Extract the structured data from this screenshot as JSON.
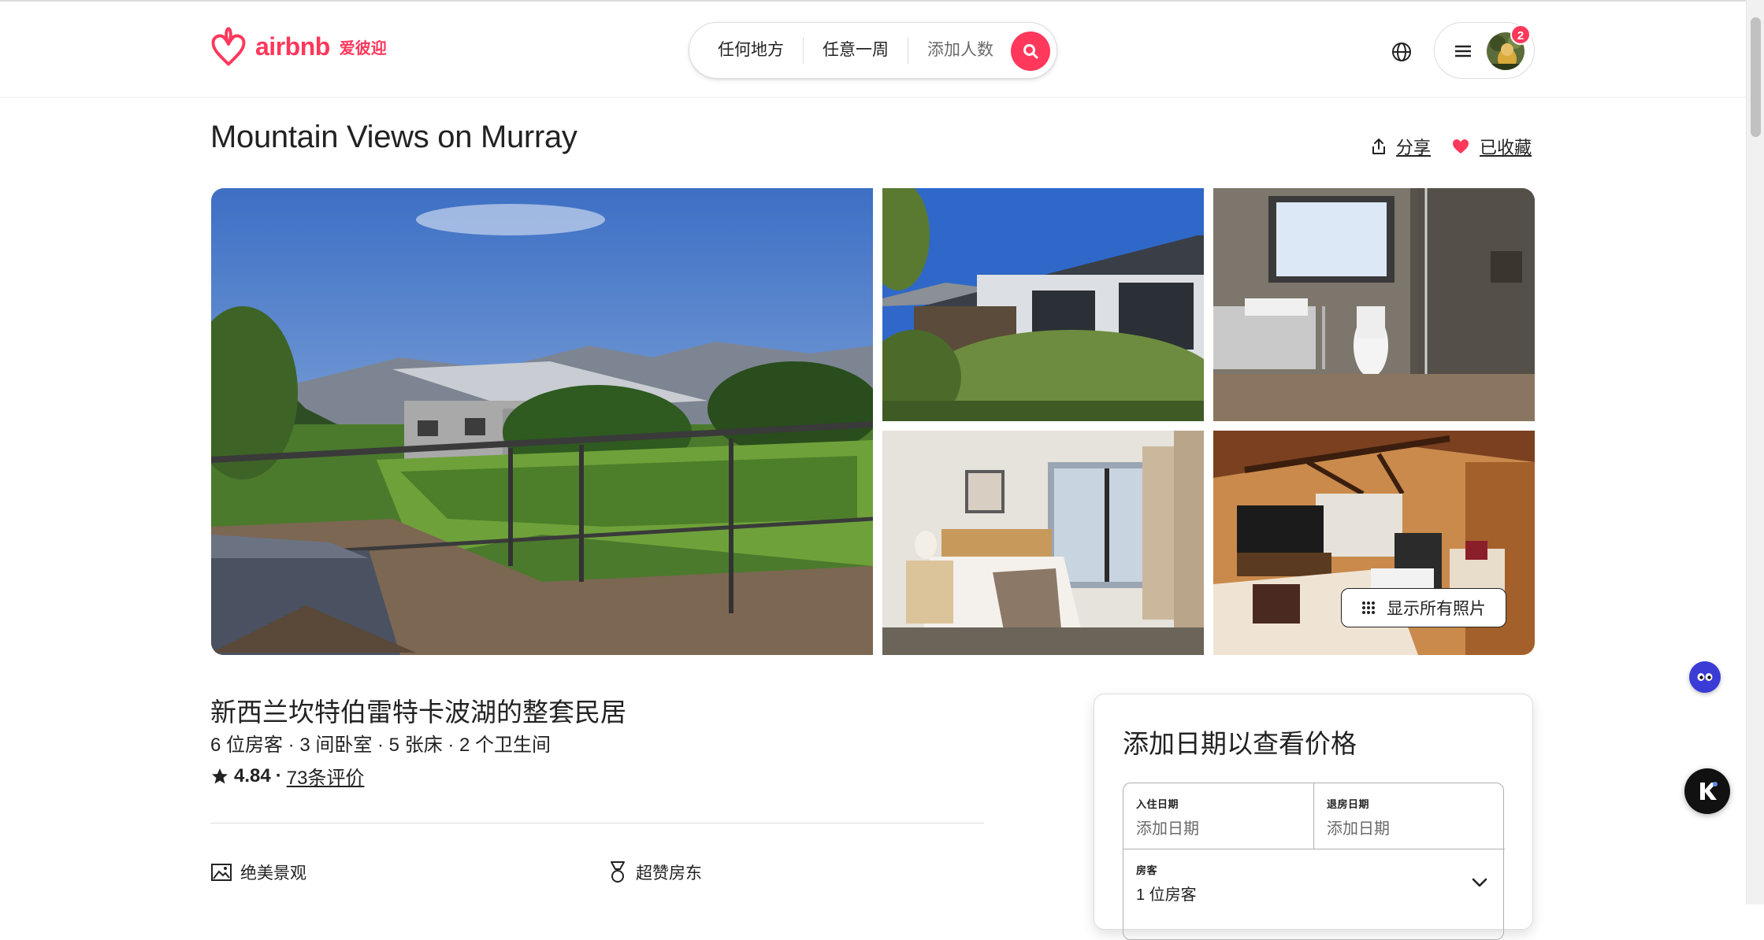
{
  "header": {
    "logo_word": "airbnb",
    "logo_cn": "爱彼迎",
    "search": {
      "where": "任何地方",
      "when": "任意一周",
      "who": "添加人数"
    },
    "notification_count": "2"
  },
  "listing": {
    "title": "Mountain Views on Murray",
    "share_label": "分享",
    "saved_label": "已收藏",
    "show_all_photos": "显示所有照片",
    "subtitle": "新西兰坎特伯雷特卡波湖的整套民居",
    "details": "6 位房客 · 3 间卧室 · 5 张床 · 2 个卫生间",
    "rating": "4.84",
    "rating_sep": "·",
    "reviews": "73条评价",
    "highlights": [
      "绝美景观",
      "超赞房东"
    ]
  },
  "booking": {
    "title": "添加日期以查看价格",
    "checkin_label": "入住日期",
    "checkin_value": "添加日期",
    "checkout_label": "退房日期",
    "checkout_value": "添加日期",
    "guests_label": "房客",
    "guests_value": "1 位房客"
  },
  "icons": {
    "logo": "airbnb-logo-icon",
    "search": "search-icon",
    "globe": "globe-icon",
    "menu": "hamburger-menu-icon",
    "share": "share-icon",
    "heart": "heart-icon",
    "grid": "grid-icon",
    "star": "star-icon",
    "view": "mountain-view-icon",
    "superhost": "medal-icon",
    "chevron": "chevron-down-icon"
  },
  "colors": {
    "brand": "#ff385c",
    "text": "#222222",
    "muted": "#6a6a6a"
  }
}
